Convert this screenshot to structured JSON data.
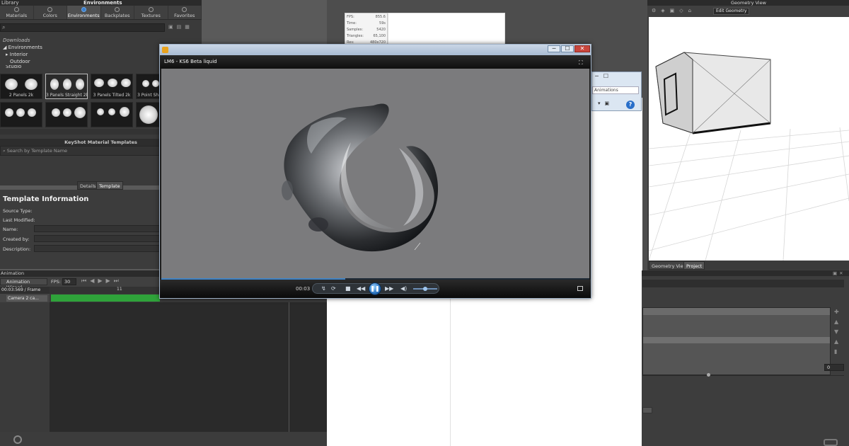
{
  "library": {
    "title": "Library",
    "subtitle": "Environments",
    "tabs": [
      {
        "label": "Materials",
        "icon": "materials-icon"
      },
      {
        "label": "Colors",
        "icon": "colors-icon"
      },
      {
        "label": "Environments",
        "icon": "environments-icon",
        "active": true
      },
      {
        "label": "Backplates",
        "icon": "backplates-icon"
      },
      {
        "label": "Textures",
        "icon": "textures-icon"
      },
      {
        "label": "Favorites",
        "icon": "favorites-icon"
      }
    ],
    "tree": [
      "Downloads",
      "Environments",
      "Interior",
      "Outdoor",
      "Studio"
    ],
    "thumbnails": [
      "2 Panels 2k",
      "3 Panels Straight 2k",
      "3 Panels Tilted 2k",
      "3 Point Sha",
      "",
      "",
      "",
      ""
    ],
    "template_header": "KeyShot Material Templates",
    "template_search_placeholder": "Search by Template Name"
  },
  "details_tabs": [
    "Details",
    "Template"
  ],
  "template_info": {
    "title": "Template Information",
    "labels": [
      "Source Type:",
      "Last Modified:",
      "Name:",
      "Created by:",
      "Description:"
    ]
  },
  "animation": {
    "title": "Animation",
    "wizard_label": "Animation Wizard",
    "fps_label": "FPS:",
    "fps_value": "30",
    "frame_info": "00:03:569 / Frame 107",
    "ruler_mark": "11",
    "camera_track": "Camera 2 ca..."
  },
  "stats": [
    {
      "label": "FPS:",
      "value": "855.6"
    },
    {
      "label": "Time:",
      "value": "59s"
    },
    {
      "label": "Samples:",
      "value": "5420"
    },
    {
      "label": "Triangles:",
      "value": "65,100"
    },
    {
      "label": "Res:",
      "value": "480x720"
    }
  ],
  "explorer": {
    "search_text": "Animations"
  },
  "player": {
    "title": "LM6 - KS6 Beta liquid",
    "time": "00:03",
    "progress": 0.43,
    "colors": {
      "accent": "#3f82c4",
      "background": "#7b7b7d"
    }
  },
  "geometry": {
    "title": "Geometry View",
    "edit_button": "Edit Geometry",
    "tabs": [
      "Geometry View",
      "Project"
    ],
    "project_value": "0"
  }
}
